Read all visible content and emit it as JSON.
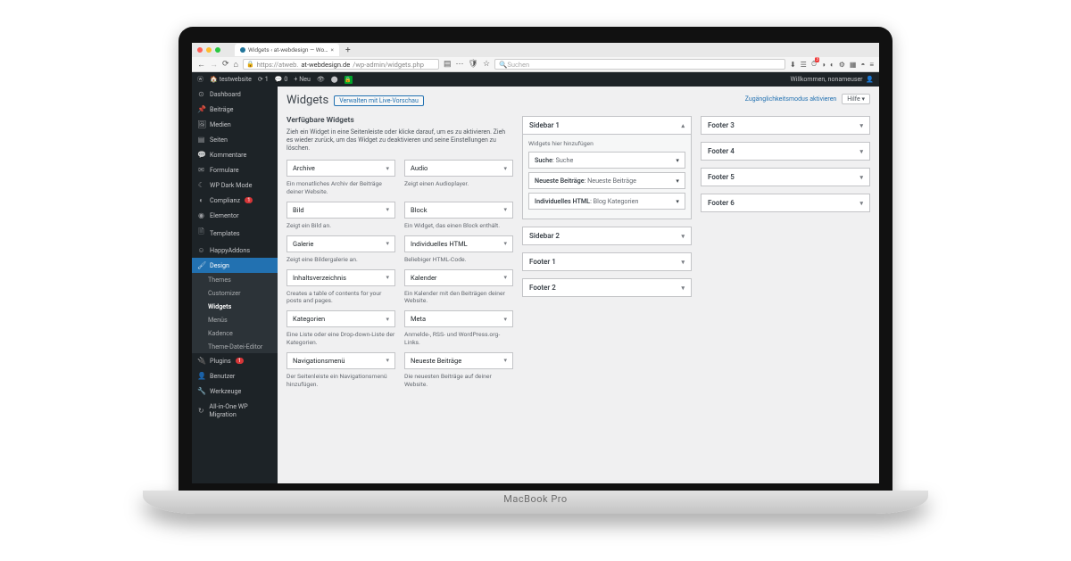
{
  "browser": {
    "tab_title": "Widgets ‹ at-webdesign — Wo…",
    "url_pre": "https://atweb.",
    "url_host": "at-webdesign.de",
    "url_path": "/wp-admin/widgets.php",
    "search_placeholder": "Suchen",
    "badge_3": "3"
  },
  "adminbar": {
    "site": "testwebsite",
    "updates": "1",
    "comments": "0",
    "new": "Neu",
    "welcome_pre": "Willkommen, ",
    "welcome_user": "nonameuser"
  },
  "menu": {
    "dashboard": "Dashboard",
    "posts": "Beiträge",
    "media": "Medien",
    "pages": "Seiten",
    "comments": "Kommentare",
    "forms": "Formulare",
    "darkmode": "WP Dark Mode",
    "complianz": "Complianz",
    "complianz_n": "1",
    "elementor": "Elementor",
    "templates": "Templates",
    "happy": "HappyAddons",
    "design": "Design",
    "sub_themes": "Themes",
    "sub_customizer": "Customizer",
    "sub_widgets": "Widgets",
    "sub_menus": "Menüs",
    "sub_kadence": "Kadence",
    "sub_editor": "Theme-Datei-Editor",
    "plugins": "Plugins",
    "plugins_n": "1",
    "users": "Benutzer",
    "tools": "Werkzeuge",
    "aio": "All-in-One WP Migration"
  },
  "page": {
    "title": "Widgets",
    "live_preview": "Verwalten mit Live-Vorschau",
    "a11y_link": "Zugänglichkeitsmodus aktivieren",
    "help": "Hilfe ▾",
    "avail_heading": "Verfügbare Widgets",
    "avail_desc": "Zieh ein Widget in eine Seitenleiste oder klicke darauf, um es zu aktivieren. Zieh es wieder zurück, um das Widget zu deaktivieren und seine Einstellungen zu löschen."
  },
  "widgets": [
    {
      "name": "Archive",
      "desc": "Ein monatliches Archiv der Beiträge deiner Website."
    },
    {
      "name": "Audio",
      "desc": "Zeigt einen Audioplayer."
    },
    {
      "name": "Bild",
      "desc": "Zeigt ein Bild an."
    },
    {
      "name": "Block",
      "desc": "Ein Widget, das einen Block enthält."
    },
    {
      "name": "Galerie",
      "desc": "Zeigt eine Bildergalerie an."
    },
    {
      "name": "Individuelles HTML",
      "desc": "Beliebiger HTML-Code."
    },
    {
      "name": "Inhaltsverzeichnis",
      "desc": "Creates a table of contents for your posts and pages."
    },
    {
      "name": "Kalender",
      "desc": "Ein Kalender mit den Beiträgen deiner Website."
    },
    {
      "name": "Kategorien",
      "desc": "Eine Liste oder eine Drop-down-Liste der Kategorien."
    },
    {
      "name": "Meta",
      "desc": "Anmelde-, RSS- und WordPress.org-Links."
    },
    {
      "name": "Navigationsmenü",
      "desc": "Der Seitenleiste ein Navigationsmenü hinzufügen."
    },
    {
      "name": "Neueste Beiträge",
      "desc": "Die neuesten Beiträge auf deiner Website."
    }
  ],
  "areas_mid": {
    "s1_title": "Sidebar 1",
    "s1_hint": "Widgets hier hinzufügen",
    "s1_items": [
      {
        "w": "Suche",
        "t": "Suche"
      },
      {
        "w": "Neueste Beiträge",
        "t": "Neueste Beiträge"
      },
      {
        "w": "Individuelles HTML",
        "t": "Blog Kategorien"
      }
    ],
    "s2_title": "Sidebar 2",
    "f1_title": "Footer 1",
    "f2_title": "Footer 2"
  },
  "areas_right": {
    "f3": "Footer 3",
    "f4": "Footer 4",
    "f5": "Footer 5",
    "f6": "Footer 6"
  },
  "base_label": "MacBook Pro"
}
